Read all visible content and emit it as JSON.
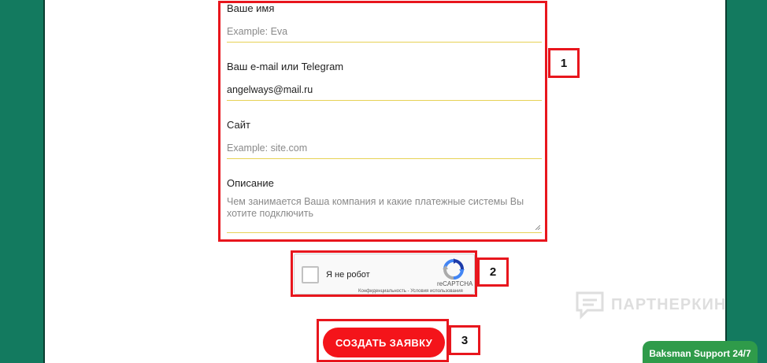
{
  "form": {
    "name": {
      "label": "Ваше имя",
      "placeholder": "Example: Eva",
      "value": ""
    },
    "contact": {
      "label": "Ваш e-mail или Telegram",
      "placeholder": "",
      "value": "angelways@mail.ru"
    },
    "site": {
      "label": "Сайт",
      "placeholder": "Example: site.com",
      "value": ""
    },
    "description": {
      "label": "Описание",
      "placeholder": "Чем занимается Ваша компания и какие платежные системы Вы хотите подключить"
    }
  },
  "captcha": {
    "checkbox_label": "Я не робот",
    "brand": "reCAPTCHA",
    "links": "Конфиденциальность - Условия использования"
  },
  "submit_label": "СОЗДАТЬ ЗАЯВКУ",
  "annotations": [
    "1",
    "2",
    "3"
  ],
  "watermark_text": "ПАРТНЕРКИН",
  "support_label": "Baksman Support 24/7",
  "colors": {
    "background": "#137a5f",
    "accent_red": "#e8161d",
    "button": "#f4141a",
    "underline": "#e7d255",
    "support": "#2f9b4a"
  }
}
